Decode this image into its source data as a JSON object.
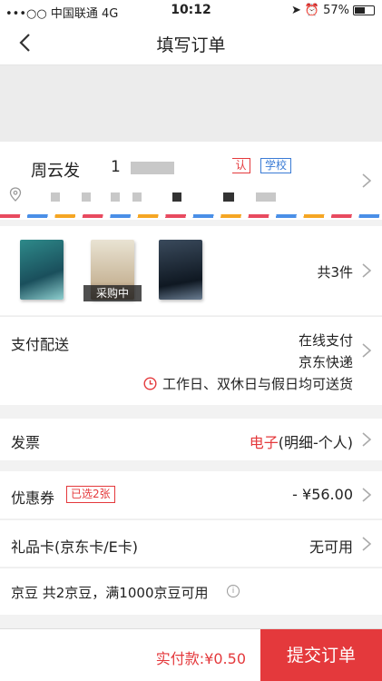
{
  "status_bar": {
    "carrier": "•••○○ 中国联通",
    "network": "4G",
    "time": "10:12",
    "battery": "57%",
    "battery_level": 0.57
  },
  "nav": {
    "title": "填写订单"
  },
  "address": {
    "name": "周云发",
    "phone_prefix": "1",
    "tag_default": "认",
    "tag_school": "学校"
  },
  "goods": {
    "count_label": "共3件",
    "badge": "采购中"
  },
  "delivery": {
    "label": "支付配送",
    "payment": "在线支付",
    "shipping": "京东快递",
    "time": "工作日、双休日与假日均可送货"
  },
  "invoice": {
    "label": "发票",
    "value_highlight": "电子",
    "value_rest": "(明细-个人)"
  },
  "coupon": {
    "label": "优惠券",
    "tag": "已选2张",
    "value": "- ¥56.00"
  },
  "giftcard": {
    "label": "礼品卡(京东卡/E卡)",
    "value": "无可用"
  },
  "beans": {
    "text": "京豆  共2京豆，满1000京豆可用"
  },
  "footer": {
    "total_label": "实付款:",
    "total_value": "¥0.50",
    "submit_label": "提交订单"
  },
  "colors": {
    "accent": "#e4393c",
    "school_tag": "#3a7bd5"
  }
}
